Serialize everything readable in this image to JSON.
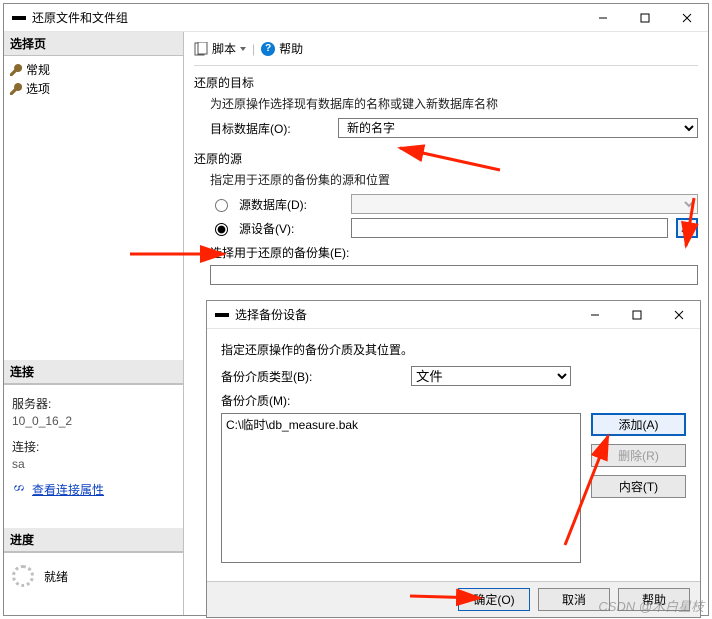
{
  "mainWindow": {
    "title": "还原文件和文件组",
    "sidebar": {
      "selectHeader": "选择页",
      "items": [
        "常规",
        "选项"
      ],
      "connHeader": "连接",
      "serverLabel": "服务器:",
      "serverValue": "10_0_16_2",
      "connLabel": "连接:",
      "connValue": "sa",
      "viewProps": "查看连接属性",
      "progressHeader": "进度",
      "progressStatus": "就绪"
    },
    "toolbar": {
      "script": "脚本",
      "help": "帮助"
    },
    "dest": {
      "title": "还原的目标",
      "sub": "为还原操作选择现有数据库的名称或键入新数据库名称",
      "dbLabel": "目标数据库(O):",
      "dbValue": "新的名字"
    },
    "source": {
      "title": "还原的源",
      "sub": "指定用于还原的备份集的源和位置",
      "fromDbLabel": "源数据库(D):",
      "fromDeviceLabel": "源设备(V):",
      "deviceValue": "",
      "setsLabel": "选择用于还原的备份集(E):"
    }
  },
  "dialog": {
    "title": "选择备份设备",
    "instruction": "指定还原操作的备份介质及其位置。",
    "mediaTypeLabel": "备份介质类型(B):",
    "mediaTypeValue": "文件",
    "mediaLabel": "备份介质(M):",
    "mediaItems": [
      "C:\\临时\\db_measure.bak"
    ],
    "btnAdd": "添加(A)",
    "btnRemove": "删除(R)",
    "btnContents": "内容(T)",
    "btnOK": "确定(O)",
    "btnCancel": "取消",
    "btnHelp": "帮助"
  },
  "watermark": "CSDN @木白星枝"
}
